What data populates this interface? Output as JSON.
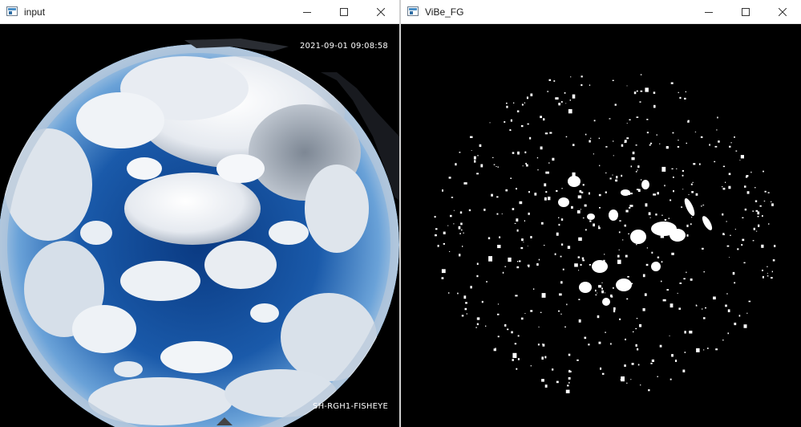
{
  "windows": {
    "input": {
      "title": "input",
      "overlay_timestamp": "2021-09-01 09:08:58",
      "overlay_camera_id": "SH-RGH1-FISHEYE",
      "image_content": "fisheye-sky-clouds"
    },
    "fg": {
      "title": "ViBe_FG",
      "image_content": "foreground-mask-white-blobs"
    }
  },
  "icons": {
    "app": "app-window-icon",
    "minimize": "minimize-icon",
    "maximize": "maximize-icon",
    "close": "close-icon"
  },
  "colors": {
    "titlebar_bg": "#ffffff",
    "sky_deep": "#0e3f86",
    "sky_light": "#5a9ad6",
    "cloud": "#f2f4f7",
    "mask_fg": "#ffffff",
    "mask_bg": "#000000"
  }
}
